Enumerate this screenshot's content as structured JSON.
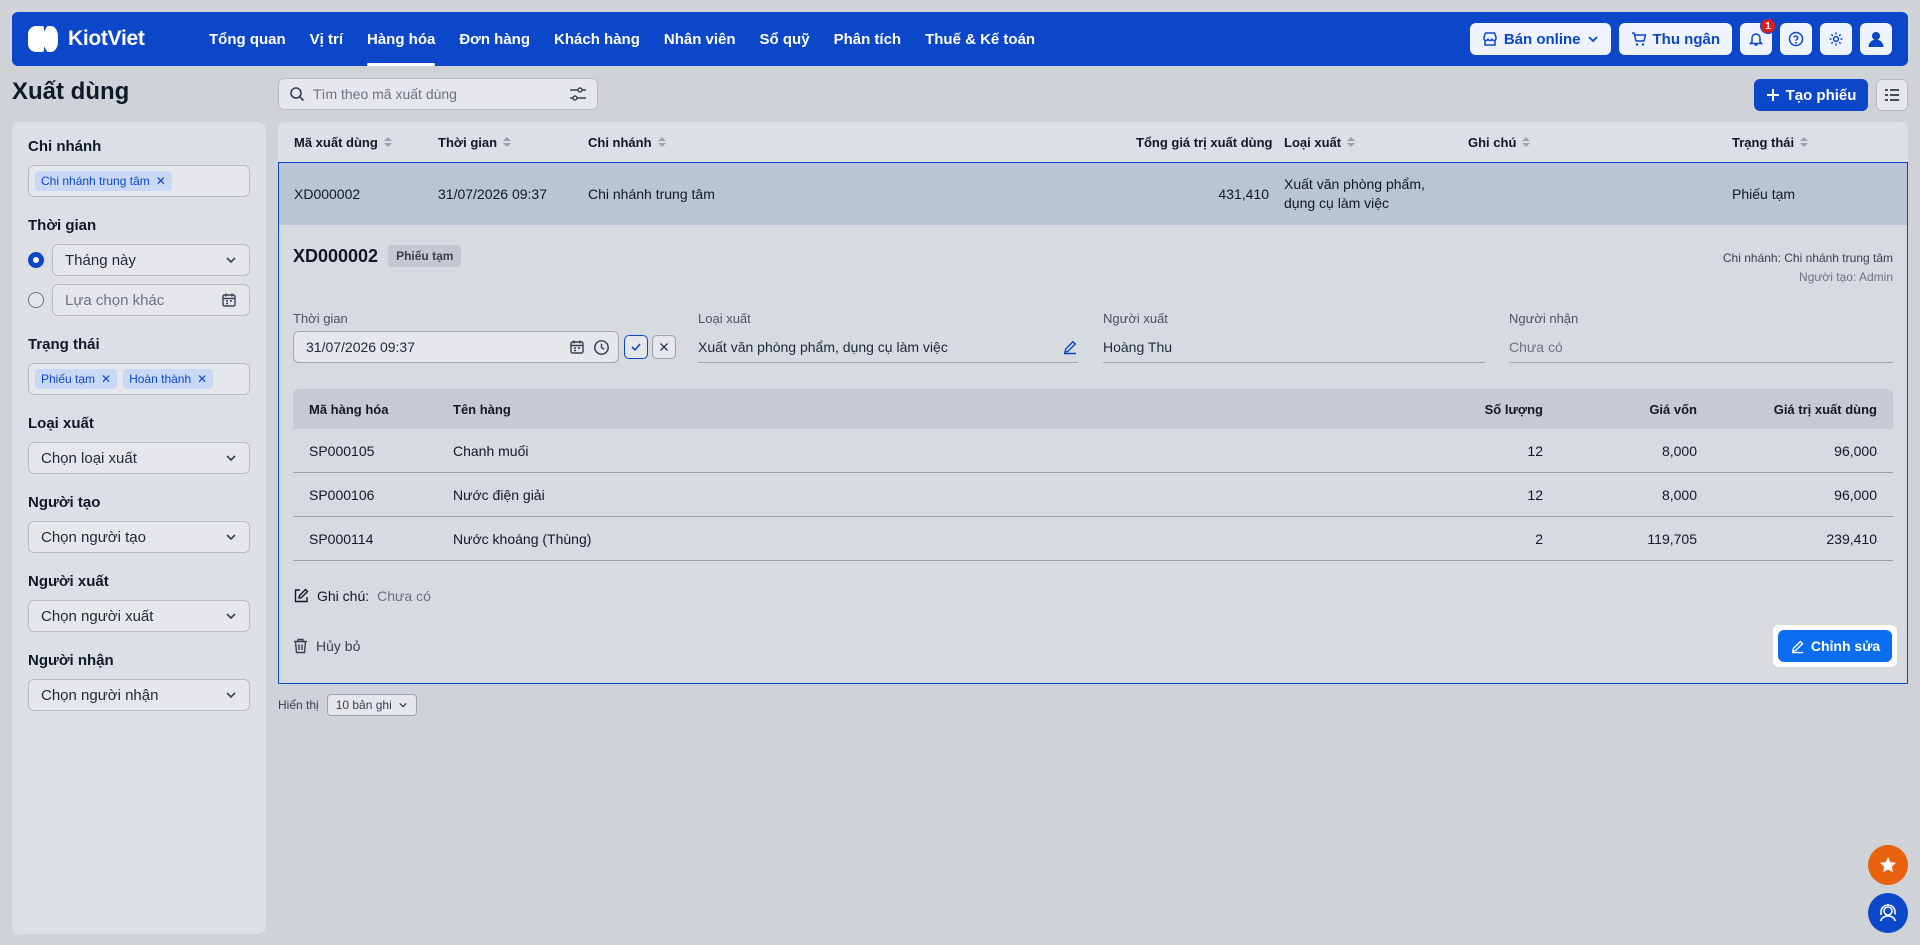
{
  "brand": {
    "name": "KiotViet"
  },
  "nav": {
    "items": [
      "Tổng quan",
      "Vị trí",
      "Hàng hóa",
      "Đơn hàng",
      "Khách hàng",
      "Nhân viên",
      "Sổ quỹ",
      "Phân tích",
      "Thuế & Kế toán"
    ],
    "active": "Hàng hóa",
    "online_label": "Bán online",
    "cashier_label": "Thu ngân",
    "notification_count": "1"
  },
  "page": {
    "title": "Xuất dùng",
    "search_placeholder": "Tìm theo mã xuất dùng",
    "create_label": "Tạo phiếu"
  },
  "filters": {
    "branch": {
      "label": "Chi nhánh",
      "tags": [
        "Chi nhánh trung tâm"
      ]
    },
    "time": {
      "label": "Thời gian",
      "preset": "Tháng này",
      "custom_placeholder": "Lựa chọn khác",
      "selected": "preset"
    },
    "status": {
      "label": "Trạng thái",
      "tags": [
        "Phiếu tạm",
        "Hoàn thành"
      ]
    },
    "export_type": {
      "label": "Loại xuất",
      "value": "Chọn loại xuất"
    },
    "creator": {
      "label": "Người tạo",
      "value": "Chọn người tạo"
    },
    "exporter": {
      "label": "Người xuất",
      "value": "Chọn người xuất"
    },
    "receiver": {
      "label": "Người nhận",
      "value": "Chọn người nhận"
    }
  },
  "table": {
    "columns": [
      "Mã xuất dùng",
      "Thời gian",
      "Chi nhánh",
      "Tổng giá trị xuất dùng",
      "Loại xuất",
      "Ghi chú",
      "Trạng thái"
    ],
    "rows": [
      {
        "code": "XD000002",
        "time": "31/07/2026 09:37",
        "branch": "Chi nhánh trung tâm",
        "total": "431,410",
        "type": "Xuất văn phòng phẩm, dụng cụ làm việc",
        "note": "",
        "status": "Phiếu tạm"
      }
    ]
  },
  "detail": {
    "code": "XD000002",
    "status": "Phiếu tạm",
    "branch_line": "Chi nhánh: Chi nhánh trung tâm",
    "creator_line": "Người tạo: Admin",
    "time_label": "Thời gian",
    "time_value": "31/07/2026 09:37",
    "type_label": "Loại xuất",
    "type_value": "Xuất văn phòng phẩm, dụng cụ làm việc",
    "exporter_label": "Người xuất",
    "exporter_value": "Hoàng Thu",
    "receiver_label": "Người nhận",
    "receiver_placeholder": "Chưa có",
    "item_columns": [
      "Mã hàng hóa",
      "Tên hàng",
      "Số lượng",
      "Giá vốn",
      "Giá trị xuất dùng"
    ],
    "items": [
      {
        "code": "SP000105",
        "name": "Chanh muối",
        "qty": "12",
        "cost": "8,000",
        "value": "96,000"
      },
      {
        "code": "SP000106",
        "name": "Nước điện giải",
        "qty": "12",
        "cost": "8,000",
        "value": "96,000"
      },
      {
        "code": "SP000114",
        "name": "Nước khoáng (Thùng)",
        "qty": "2",
        "cost": "119,705",
        "value": "239,410"
      }
    ],
    "note_label": "Ghi chú:",
    "note_value": "Chưa có",
    "cancel_label": "Hủy bỏ",
    "edit_label": "Chỉnh sửa"
  },
  "pager": {
    "label": "Hiển thị",
    "value": "10 bản ghi"
  },
  "colors": {
    "primary": "#0c47c9",
    "accent": "#0b6ef0",
    "fab_orange": "#e8610e"
  }
}
